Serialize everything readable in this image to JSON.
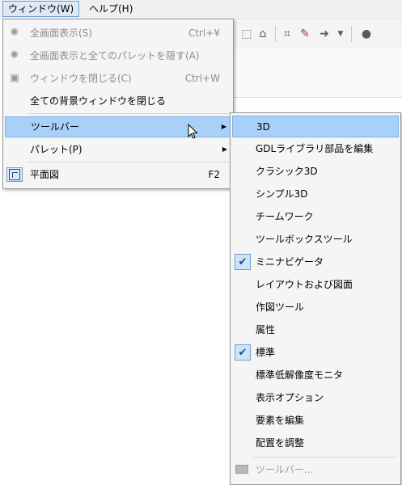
{
  "menubar": {
    "window": "ウィンドウ(W)",
    "help": "ヘルプ(H)"
  },
  "window_menu": {
    "items": [
      {
        "label": "全画面表示(S)",
        "shortcut": "Ctrl+¥",
        "icon": "gear-icon",
        "disabled": true
      },
      {
        "label": "全画面表示と全てのパレットを隠す(A)",
        "shortcut": "",
        "icon": "gear-icon",
        "disabled": true
      },
      {
        "label": "ウィンドウを閉じる(C)",
        "shortcut": "Ctrl+W",
        "icon": "close-window-icon",
        "disabled": true
      },
      {
        "label": "全ての背景ウィンドウを閉じる",
        "shortcut": "",
        "disabled": false
      },
      {
        "label": "ツールバー",
        "submenu": true,
        "highlighted": true
      },
      {
        "label": "パレット(P)",
        "submenu": true
      },
      {
        "label": "平面図",
        "shortcut": "F2",
        "icon": "floor-plan-icon"
      }
    ]
  },
  "toolbar_menu": {
    "items": [
      {
        "label": "3D",
        "highlighted": true
      },
      {
        "label": "GDLライブラリ部品を編集"
      },
      {
        "label": "クラシック3D"
      },
      {
        "label": "シンプル3D"
      },
      {
        "label": "チームワーク"
      },
      {
        "label": "ツールボックスツール"
      },
      {
        "label": "ミニナビゲータ",
        "checked": true
      },
      {
        "label": "レイアウトおよび図面"
      },
      {
        "label": "作図ツール"
      },
      {
        "label": "属性"
      },
      {
        "label": "標準",
        "checked": true
      },
      {
        "label": "標準低解像度モニタ"
      },
      {
        "label": "表示オプション"
      },
      {
        "label": "要素を編集"
      },
      {
        "label": "配置を調整"
      },
      {
        "label": "ツールバー...",
        "disabled": true
      }
    ],
    "check_glyph": "✔"
  },
  "colors": {
    "highlight": "#a8d0f8",
    "menu_bg": "#f5f5f5",
    "disabled": "#8d8d8d"
  }
}
